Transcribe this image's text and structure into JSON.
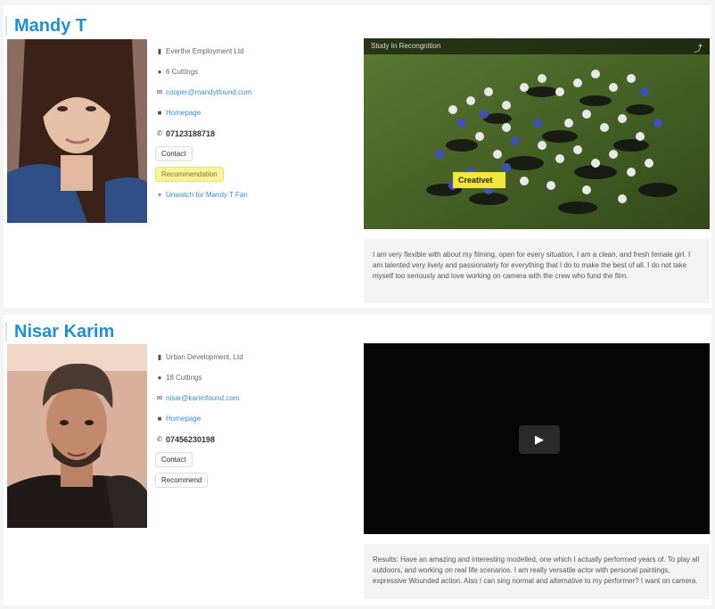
{
  "profiles": [
    {
      "name": "Mandy T",
      "details": {
        "agency": "Everthe Employment Ltd",
        "age": "6 Cuttings",
        "email": "cooper@mandytfound.com",
        "website": "Homepage",
        "phone": "07123188718",
        "button1": "Contact",
        "button2": "Recommendation",
        "extra_link": "Unwatch for Mandy T Fan"
      },
      "video": {
        "title": "Study In Recongnition",
        "label": "Creativet",
        "has_play_button": false
      },
      "description": "I am very flexible with about my filming, open for every situation, I am a clean, and fresh female girl. I am talented very lively and passionately for everything that I do to make the best of all. I do not take myself too seriously and love working on camera with the crew who fund the film."
    },
    {
      "name": "Nisar Karim",
      "details": {
        "agency": "Urban Development, Ltd",
        "age": "18 Cuttings",
        "email": "nisar@karimfound.com",
        "website": "Homepage",
        "phone": "07456230198",
        "button1": "Contact",
        "button2": "Recommend",
        "extra_link": ""
      },
      "video": {
        "title": "",
        "label": "",
        "has_play_button": true
      },
      "description": "Results: Have an amazing and interesting modelled, one which I actually performed years of. To play all outdoors, and working on real life scenarios. I am really versatile actor with personal paintings, expressive Wounded action. Also I can sing normal and alternative to my performer? I want on camera."
    }
  ],
  "colors": {
    "name": "#1e90d6",
    "link": "#3a8ed0",
    "highlight": "#f8f49a",
    "field": "#3d5a22"
  }
}
